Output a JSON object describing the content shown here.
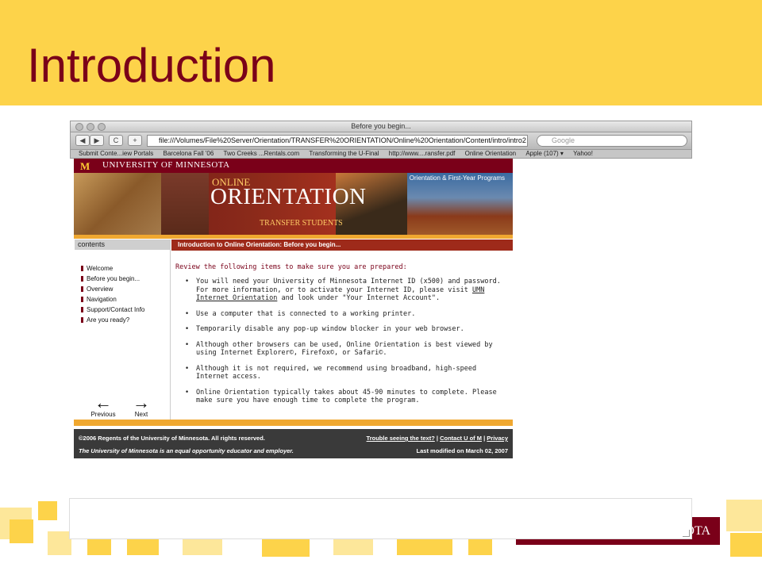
{
  "slide": {
    "title": "Introduction"
  },
  "browser": {
    "window_title": "Before you begin...",
    "url": "file:///Volumes/File%20Server/Orientation/TRANSFER%20ORIENTATION/Online%20Orientation/Content/intro/intro2",
    "search_placeholder": "Google",
    "bookmarks": [
      "Submit Conte...iew Portals",
      "Barcelona Fall '06",
      "Two Creeks ...Rentals.com",
      "Transforming the U-Final",
      "http://www....ransfer.pdf",
      "Online Orientation",
      "Apple (107) ▾",
      "Yahoo!"
    ],
    "buttons": {
      "back": "◀",
      "forward": "▶",
      "reload": "C",
      "add": "+"
    }
  },
  "site": {
    "university": "University of Minnesota",
    "university_mark": "M",
    "program_link": "Orientation & First-Year Programs",
    "banner_online": "ONLINE",
    "banner_orientation": "ORIENTATION",
    "banner_transfer": "TRANSFER STUDENTS"
  },
  "sidebar": {
    "heading": "contents",
    "items": [
      "Welcome",
      "Before you begin...",
      "Overview",
      "Navigation",
      "Support/Contact Info",
      "Are you ready?"
    ],
    "previous": "Previous",
    "next": "Next"
  },
  "main": {
    "heading": "Introduction to Online Orientation: Before you begin...",
    "intro": "Review the following items to make sure you are prepared:",
    "req1_a": "You will need your University of Minnesota Internet ID (x500) and password. For more information, or to activate your Internet ID, please visit ",
    "req1_link": "UMN Internet Orientation",
    "req1_b": " and look under \"Your Internet Account\".",
    "req2": "Use a computer that is connected to a working printer.",
    "req3": "Temporarily disable any pop-up window blocker in your web browser.",
    "req4": "Although other browsers can be used, Online Orientation is best viewed by using Internet Explorer©, Firefox©, or Safari©.",
    "req5": "Although it is not required, we recommend using broadband, high-speed Internet access.",
    "req6": "Online Orientation typically takes about 45-90 minutes to complete. Please make sure you have enough time to complete the program."
  },
  "footer": {
    "copyright": "©2006 Regents of the University of Minnesota. All rights reserved.",
    "eeo": "The University of Minnesota is an equal opportunity educator and employer.",
    "link1": "Trouble seeing the text?",
    "link2": "Contact U of M",
    "link3": "Privacy",
    "sep": " | ",
    "modified": "Last modified on March 02, 2007"
  },
  "bottom_logo": "OTA",
  "colors": {
    "gold": "#fdd34a",
    "maroon": "#7a0019",
    "accent": "#f0a830"
  }
}
